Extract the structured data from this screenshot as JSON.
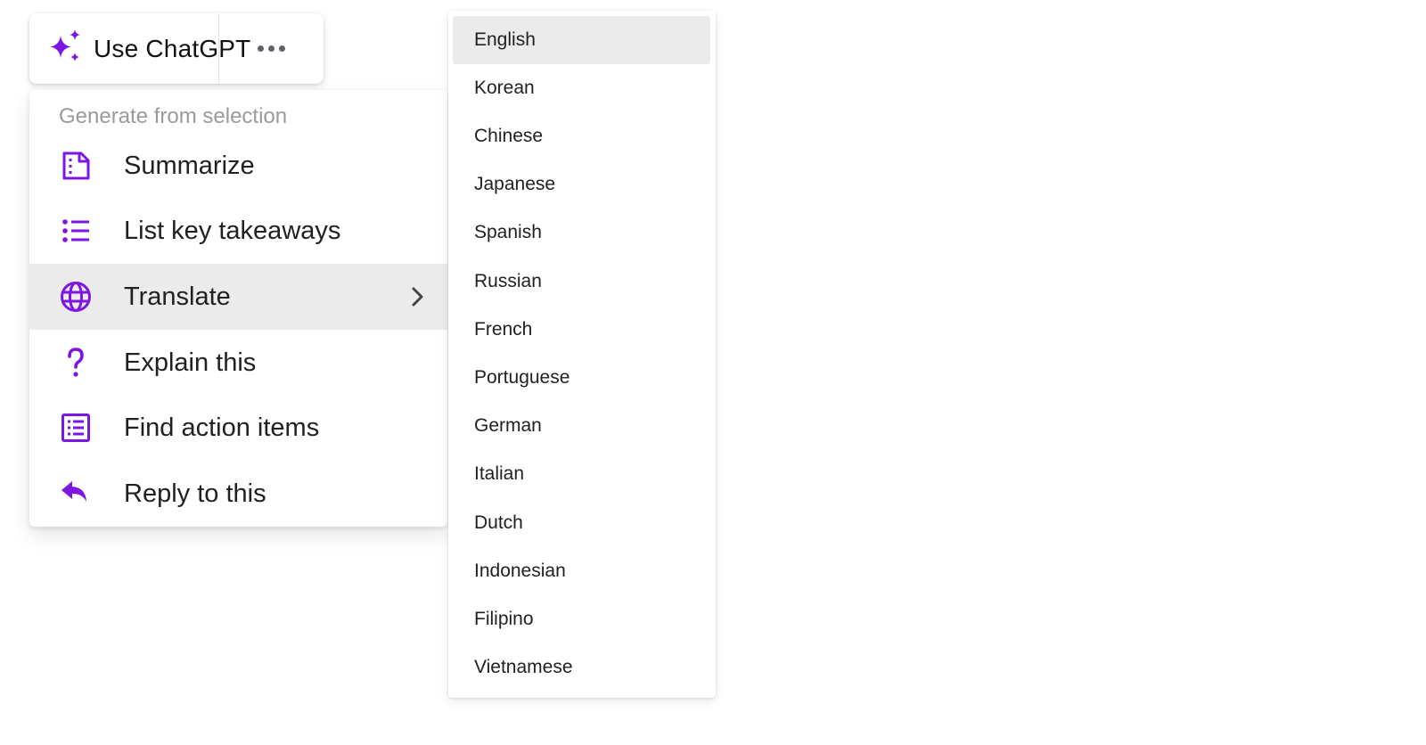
{
  "toolbar": {
    "use_label": "Use ChatGPT",
    "icon": "sparkle-icon",
    "more_icon": "more-horizontal-icon"
  },
  "colors": {
    "accent": "#7c16e0",
    "hover_bg": "#ebebeb",
    "header_text": "#9a9a9a"
  },
  "menu": {
    "header": "Generate from selection",
    "items": [
      {
        "label": "Summarize",
        "icon": "document-icon"
      },
      {
        "label": "List key takeaways",
        "icon": "list-icon"
      },
      {
        "label": "Translate",
        "icon": "globe-icon",
        "active": true,
        "submenu": true
      },
      {
        "label": "Explain this",
        "icon": "question-mark-icon"
      },
      {
        "label": "Find action items",
        "icon": "checklist-icon"
      },
      {
        "label": "Reply to this",
        "icon": "reply-icon"
      }
    ]
  },
  "languages": {
    "selected": "English",
    "items": [
      "English",
      "Korean",
      "Chinese",
      "Japanese",
      "Spanish",
      "Russian",
      "French",
      "Portuguese",
      "German",
      "Italian",
      "Dutch",
      "Indonesian",
      "Filipino",
      "Vietnamese"
    ]
  }
}
